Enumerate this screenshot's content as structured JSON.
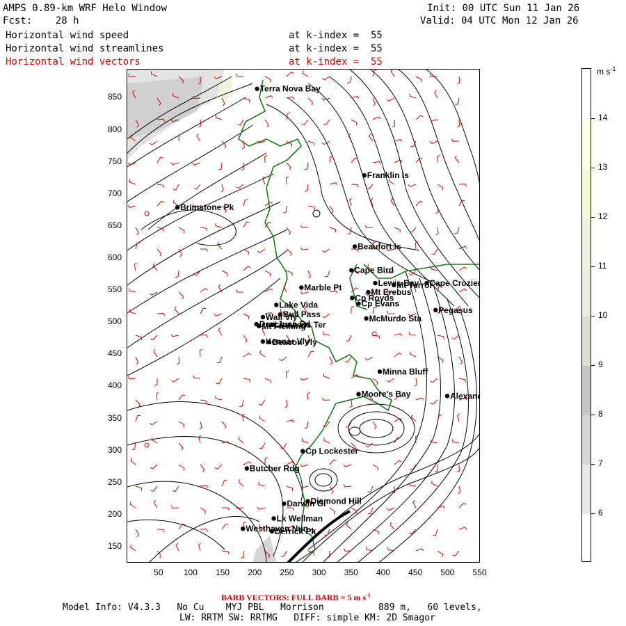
{
  "header": {
    "title": "AMPS 0.89-km WRF Helo Window",
    "fcst": "Fcst:    28 h",
    "init": "Init: 00 UTC Sun 11 Jan 26",
    "valid": "Valid: 04 UTC Mon 12 Jan 26",
    "fields": [
      {
        "name": "Horizontal wind speed",
        "level": "at k-index =  55",
        "color": "#000000"
      },
      {
        "name": "Horizontal wind streamlines",
        "level": "at k-index =  55",
        "color": "#000000"
      },
      {
        "name": "Horizontal wind vectors",
        "level": "at k-index =  55",
        "color": "#d40000"
      }
    ]
  },
  "axes": {
    "x_ticks": [
      "50",
      "100",
      "150",
      "200",
      "250",
      "300",
      "350",
      "400",
      "450",
      "500",
      "550"
    ],
    "y_ticks": [
      "150",
      "200",
      "250",
      "300",
      "350",
      "400",
      "450",
      "500",
      "550",
      "600",
      "650",
      "700",
      "750",
      "800",
      "850"
    ],
    "xlim": [
      0,
      550
    ],
    "ylim": [
      125,
      895
    ]
  },
  "colorbar": {
    "unit_label": "m s",
    "unit_exp": "-1",
    "ticks": [
      "6",
      "7",
      "8",
      "9",
      "10",
      "11",
      "12",
      "13",
      "14"
    ],
    "colors": [
      "#ffffff",
      "#e8e8e8",
      "#d6d6d6",
      "#c6c6c6",
      "#dcdcd0",
      "#ecece0",
      "#f2f2dc",
      "#fafad2",
      "#ffffe0"
    ]
  },
  "places": [
    {
      "name": "Terra Nova Bay",
      "x": 202,
      "y": 865
    },
    {
      "name": "Franklin Is",
      "x": 369,
      "y": 730
    },
    {
      "name": "Brimstone Pk",
      "x": 78,
      "y": 680
    },
    {
      "name": "Beaufort Is",
      "x": 354,
      "y": 619
    },
    {
      "name": "Cape Bird",
      "x": 349,
      "y": 582
    },
    {
      "name": "Lewis Bay",
      "x": 386,
      "y": 562
    },
    {
      "name": "Cape Crozier",
      "x": 466,
      "y": 562
    },
    {
      "name": "Mt Terror",
      "x": 415,
      "y": 559
    },
    {
      "name": "Marble Pt",
      "x": 271,
      "y": 555
    },
    {
      "name": "Mt Erebus",
      "x": 375,
      "y": 548
    },
    {
      "name": "Cp Royds",
      "x": 350,
      "y": 539
    },
    {
      "name": "Lake Vida",
      "x": 232,
      "y": 528
    },
    {
      "name": "Cp Evans",
      "x": 360,
      "y": 530
    },
    {
      "name": "Pegasus",
      "x": 480,
      "y": 520
    },
    {
      "name": "Wall Vly",
      "x": 211,
      "y": 509
    },
    {
      "name": "Bull Pass",
      "x": 238,
      "y": 513
    },
    {
      "name": "McMurdo Sta",
      "x": 372,
      "y": 507
    },
    {
      "name": "Don Juan Pd",
      "x": 201,
      "y": 498
    },
    {
      "name": "Mt Fleming",
      "x": 205,
      "y": 495
    },
    {
      "name": "Linnaeus Ter",
      "x": 225,
      "y": 497
    },
    {
      "name": "Kennar Vly",
      "x": 211,
      "y": 471
    },
    {
      "name": "Beacon Vly",
      "x": 221,
      "y": 470
    },
    {
      "name": "Minna Bluff",
      "x": 393,
      "y": 424
    },
    {
      "name": "Moore's Bay",
      "x": 360,
      "y": 389
    },
    {
      "name": "Alexander",
      "x": 498,
      "y": 386
    },
    {
      "name": "Cp Lockester",
      "x": 273,
      "y": 300
    },
    {
      "name": "Butcher Rdg",
      "x": 186,
      "y": 273
    },
    {
      "name": "Darwin Gl",
      "x": 244,
      "y": 218
    },
    {
      "name": "Diamond Hill",
      "x": 281,
      "y": 222
    },
    {
      "name": "Lk Wellman",
      "x": 228,
      "y": 195
    },
    {
      "name": "Westhaven Nun",
      "x": 180,
      "y": 179
    },
    {
      "name": "Derrick Pk",
      "x": 225,
      "y": 175
    }
  ],
  "footer": {
    "barb_note": "BARB VECTORS:  FULL BARB = 5 m s",
    "barb_exp": "-1",
    "model_info": "Model Info: V4.3.3   No Cu    MYJ PBL   Morrison          889 m,   60 levels,",
    "physics": "LW: RRTM SW: RRTMG   DIFF: simple KM: 2D Smagor"
  }
}
